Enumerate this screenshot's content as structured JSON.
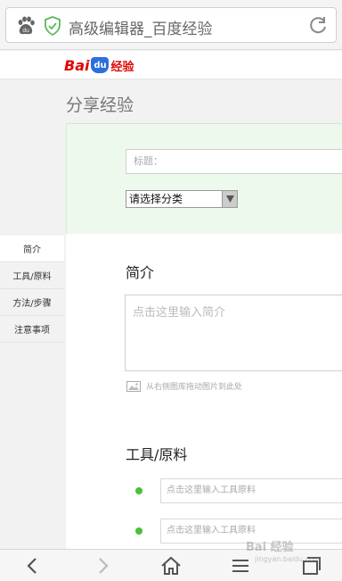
{
  "browser": {
    "url_title": "高级编辑器_百度经验"
  },
  "logo": {
    "bai": "Bai",
    "du": "du",
    "jingyan": "经验"
  },
  "page": {
    "title": "分享经验"
  },
  "side_nav": {
    "items": [
      {
        "label": "简介"
      },
      {
        "label": "工具/原料"
      },
      {
        "label": "方法/步骤"
      },
      {
        "label": "注意事项"
      }
    ]
  },
  "form": {
    "title_placeholder": "标题：",
    "category_value": "请选择分类"
  },
  "intro": {
    "heading": "简介",
    "placeholder": "点击这里输入简介",
    "image_hint": "从右侧图库拖动图片到此处"
  },
  "tools": {
    "heading": "工具/原料",
    "placeholders": [
      "点击这里输入工具原料",
      "点击这里输入工具原料"
    ]
  },
  "watermark": {
    "main": "Bai 经验",
    "sub": "jingyan.baidu.com"
  },
  "colors": {
    "green_panel": "#eef9ee",
    "bullet_green": "#4bbf3a",
    "brand_red": "#e10602",
    "brand_blue": "#2d6ee0"
  }
}
